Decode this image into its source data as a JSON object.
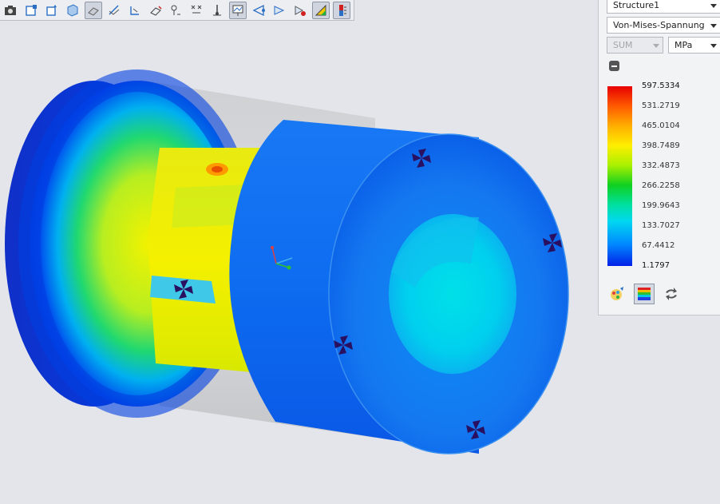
{
  "toolbar": {
    "buttons": [
      {
        "icon": "camera-icon"
      },
      {
        "icon": "new-window-icon"
      },
      {
        "icon": "insert-window-icon"
      },
      {
        "icon": "model-view-icon"
      },
      {
        "icon": "clipping-plane-icon"
      },
      {
        "icon": "section-cut-icon"
      },
      {
        "icon": "cap-surface-icon"
      },
      {
        "icon": "isosurface-icon"
      },
      {
        "icon": "query-icon"
      },
      {
        "icon": "max-min-icon"
      },
      {
        "icon": "probe-icon"
      },
      {
        "icon": "graph-icon"
      },
      {
        "icon": "deformed-icon"
      },
      {
        "icon": "animation-icon"
      },
      {
        "icon": "vectors-icon"
      },
      {
        "icon": "fringe-icon"
      },
      {
        "icon": "legend-icon"
      }
    ]
  },
  "panel": {
    "analysis": "Structure1",
    "quantity": "Von-Mises-Spannung",
    "component": "SUM",
    "unit": "MPa",
    "legend_values": [
      "597.5334",
      "531.2719",
      "465.0104",
      "398.7489",
      "332.4873",
      "266.2258",
      "199.9643",
      "133.7027",
      "67.4412",
      "1.1797"
    ],
    "icons": [
      "color-settings-icon",
      "gradient-legend-icon",
      "refresh-icon"
    ]
  },
  "colors": {
    "max": "#e80000",
    "min": "#0020e8",
    "background": "#e4e5ea"
  }
}
